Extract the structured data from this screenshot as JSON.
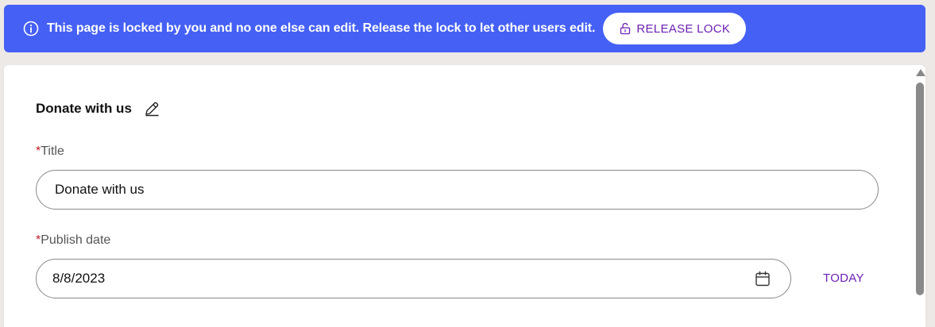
{
  "banner": {
    "text_pre": "This page is ",
    "text_strong": "locked by you",
    "text_post": " and no one else can edit. Release the lock to let other users edit.",
    "release_label": "RELEASE LOCK",
    "background_color": "#4560f5",
    "info_icon": "info-circle-icon",
    "unlock_icon": "unlock-icon"
  },
  "form": {
    "heading": "Donate with us",
    "edit_icon": "pencil-icon",
    "title_field": {
      "required_mark": "*",
      "label": "Title",
      "value": "Donate with us"
    },
    "publish_date_field": {
      "required_mark": "*",
      "label": "Publish date",
      "value": "8/8/2023",
      "calendar_icon": "calendar-icon"
    },
    "today_label": "TODAY",
    "accent_color": "#6d1fb5"
  }
}
